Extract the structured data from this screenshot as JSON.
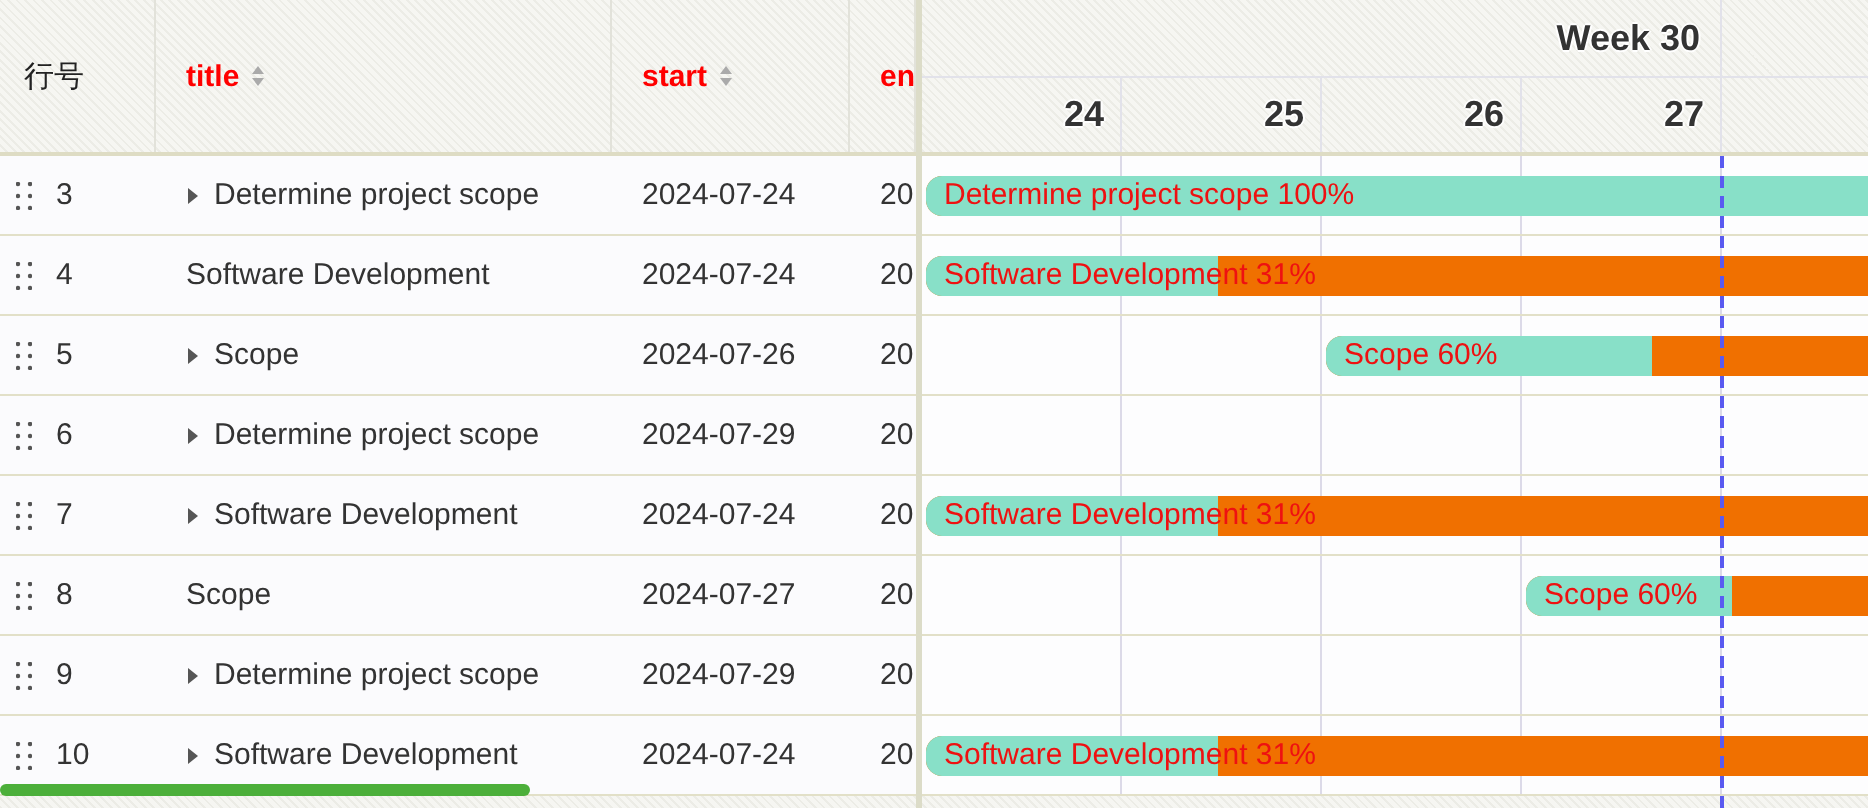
{
  "columns": [
    {
      "label": "行号",
      "kind": "plain"
    },
    {
      "label": "title",
      "kind": "sortable"
    },
    {
      "label": "start",
      "kind": "sortable"
    },
    {
      "label": "en",
      "kind": "cut"
    }
  ],
  "timeline": {
    "week": "Week 30",
    "days": [
      "24",
      "25",
      "26",
      "27"
    ]
  },
  "rows": [
    {
      "number": "3",
      "title": "Determine project scope",
      "kind": "branch",
      "start": "2024-07-24",
      "end": "20",
      "bar": {
        "label": "Determine project scope 100%",
        "level": 1
      }
    },
    {
      "number": "4",
      "title": "Software Development",
      "kind": "leaf",
      "start": "2024-07-24",
      "end": "20",
      "bar": {
        "label": "Software Development 31%",
        "level": 0.31
      }
    },
    {
      "number": "5",
      "title": "Scope",
      "kind": "branch",
      "start": "2024-07-26",
      "end": "20",
      "bar": {
        "label": "Scope 60%",
        "level": 0.6
      }
    },
    {
      "number": "6",
      "title": "Determine project scope",
      "kind": "branch",
      "start": "2024-07-29",
      "end": "20"
    },
    {
      "number": "7",
      "title": "Software Development",
      "kind": "branch",
      "start": "2024-07-24",
      "end": "20",
      "bar": {
        "label": "Software Development 31%",
        "level": 0.31
      }
    },
    {
      "number": "8",
      "title": "Scope",
      "kind": "leaf",
      "start": "2024-07-27",
      "end": "20",
      "bar": {
        "label": "Scope 60%",
        "level": 0.6
      }
    },
    {
      "number": "9",
      "title": "Determine project scope",
      "kind": "branch",
      "start": "2024-07-29",
      "end": "20"
    },
    {
      "number": "10",
      "title": "Software Development",
      "kind": "branch",
      "start": "2024-07-24",
      "end": "20",
      "bar": {
        "label": "Software Development 31%",
        "level": 0.31
      }
    }
  ]
}
